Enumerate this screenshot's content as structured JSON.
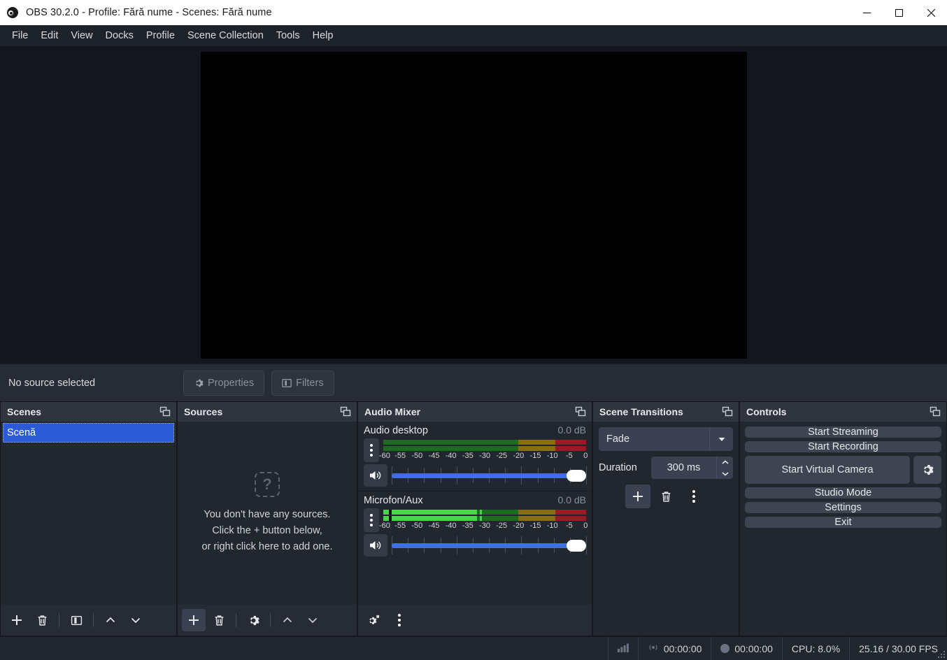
{
  "window": {
    "title": "OBS 30.2.0 - Profile: Fără nume - Scenes: Fără nume",
    "logo_icon": "obs-logo-icon",
    "minimize_icon": "minimize-icon",
    "maximize_icon": "maximize-icon",
    "close_icon": "close-icon"
  },
  "menubar": {
    "items": [
      {
        "label": "File"
      },
      {
        "label": "Edit"
      },
      {
        "label": "View"
      },
      {
        "label": "Docks"
      },
      {
        "label": "Profile"
      },
      {
        "label": "Scene Collection"
      },
      {
        "label": "Tools"
      },
      {
        "label": "Help"
      }
    ]
  },
  "preview": {
    "canvas_color": "#000000"
  },
  "source_toolbar": {
    "status": "No source selected",
    "properties_label": "Properties",
    "properties_icon": "gear-icon",
    "filters_label": "Filters",
    "filters_icon": "filters-icon"
  },
  "scenes": {
    "title": "Scenes",
    "popout_icon": "popout-icon",
    "items": [
      {
        "label": "Scenă",
        "selected": true
      }
    ],
    "tools": [
      {
        "name": "add-scene-button",
        "icon": "plus-icon"
      },
      {
        "name": "remove-scene-button",
        "icon": "trash-icon"
      },
      {
        "name": "scene-filters-button",
        "icon": "filters-icon"
      },
      {
        "name": "move-scene-up-button",
        "icon": "chevron-up-icon"
      },
      {
        "name": "move-scene-down-button",
        "icon": "chevron-down-icon"
      }
    ]
  },
  "sources": {
    "title": "Sources",
    "popout_icon": "popout-icon",
    "empty_icon": "question-box-icon",
    "empty_line1": "You don't have any sources.",
    "empty_line2": "Click the + button below,",
    "empty_line3": "or right click here to add one.",
    "tools": [
      {
        "name": "add-source-button",
        "icon": "plus-icon"
      },
      {
        "name": "remove-source-button",
        "icon": "trash-icon"
      },
      {
        "name": "source-properties-button",
        "icon": "gear-icon"
      },
      {
        "name": "move-source-up-button",
        "icon": "chevron-up-icon"
      },
      {
        "name": "move-source-down-button",
        "icon": "chevron-down-icon"
      }
    ]
  },
  "mixer": {
    "title": "Audio Mixer",
    "popout_icon": "popout-icon",
    "tick_labels": [
      "-60",
      "-55",
      "-50",
      "-45",
      "-40",
      "-35",
      "-30",
      "-25",
      "-20",
      "-15",
      "-10",
      "-5",
      "0"
    ],
    "channels": [
      {
        "name": "Audio desktop",
        "db": "0.0 dB",
        "level_db": -60,
        "peak_db": -60,
        "volume_percent": 100,
        "menu_icon": "kebab-menu-icon",
        "speaker_icon": "speaker-on-icon"
      },
      {
        "name": "Microfon/Aux",
        "db": "0.0 dB",
        "level_db": -32.2,
        "peak_db": -31.5,
        "volume_percent": 100,
        "menu_icon": "kebab-menu-icon",
        "speaker_icon": "speaker-on-icon"
      }
    ],
    "tools": [
      {
        "name": "audio-advanced-properties-button",
        "icon": "gears-icon"
      },
      {
        "name": "audio-mixer-menu-button",
        "icon": "kebab-menu-icon"
      }
    ]
  },
  "transitions": {
    "title": "Scene Transitions",
    "popout_icon": "popout-icon",
    "transition": "Fade",
    "dropdown_icon": "chevron-down-icon",
    "duration_label": "Duration",
    "duration_value": "300 ms",
    "spin_up_icon": "chevron-up-icon",
    "spin_down_icon": "chevron-down-icon",
    "tools": [
      {
        "name": "add-transition-button",
        "icon": "plus-icon"
      },
      {
        "name": "remove-transition-button",
        "icon": "trash-icon"
      },
      {
        "name": "transition-menu-button",
        "icon": "kebab-menu-icon"
      }
    ]
  },
  "controls": {
    "title": "Controls",
    "popout_icon": "popout-icon",
    "start_streaming": "Start Streaming",
    "start_recording": "Start Recording",
    "start_virtual_camera": "Start Virtual Camera",
    "virtual_camera_settings_icon": "gear-icon",
    "studio_mode": "Studio Mode",
    "settings": "Settings",
    "exit": "Exit"
  },
  "statusbar": {
    "signal_icon": "signal-bars-icon",
    "stream_icon": "broadcast-icon",
    "stream_time": "00:00:00",
    "record_icon": "record-dot-icon",
    "record_time": "00:00:00",
    "cpu": "CPU: 8.0%",
    "fps": "25.16 / 30.00 FPS"
  }
}
